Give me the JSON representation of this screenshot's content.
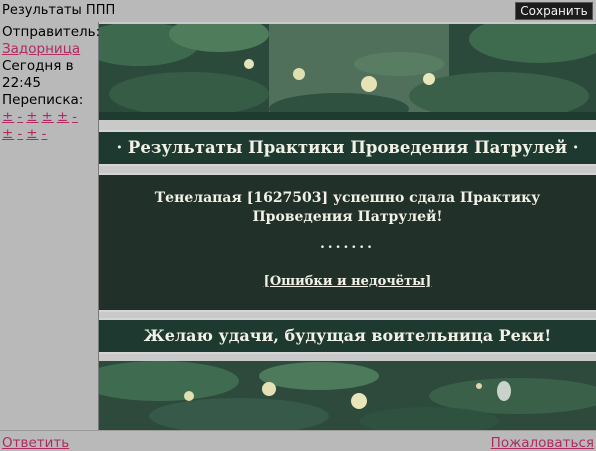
{
  "window": {
    "title": "Результаты ППП",
    "save_label": "Сохранить"
  },
  "sidebar": {
    "sender_label": "Отправитель:",
    "sender_name": "Задорница",
    "time_line1": "Сегодня в",
    "time_line2": "22:45",
    "thread_label": "Переписка:",
    "thread_links_row1": [
      "±",
      "-",
      "±",
      "±",
      "±",
      "-"
    ],
    "thread_links_row2": [
      "±",
      "-",
      "±",
      "-"
    ]
  },
  "message": {
    "title": "· Результаты Практики Проведения Патрулей ·",
    "body": "Тенелапая [1627503] успешно сдала Практику Проведения Патрулей!",
    "dots": ".......",
    "errors_link": "[Ошибки и недочёты]",
    "wish": "Желаю удачи, будущая воительница Реки!"
  },
  "footer": {
    "reply": "Ответить",
    "report": "Пожаловаться"
  },
  "colors": {
    "panel_green": "#1e3a30",
    "link": "#b02a63",
    "chrome": "#b9b9b9"
  }
}
